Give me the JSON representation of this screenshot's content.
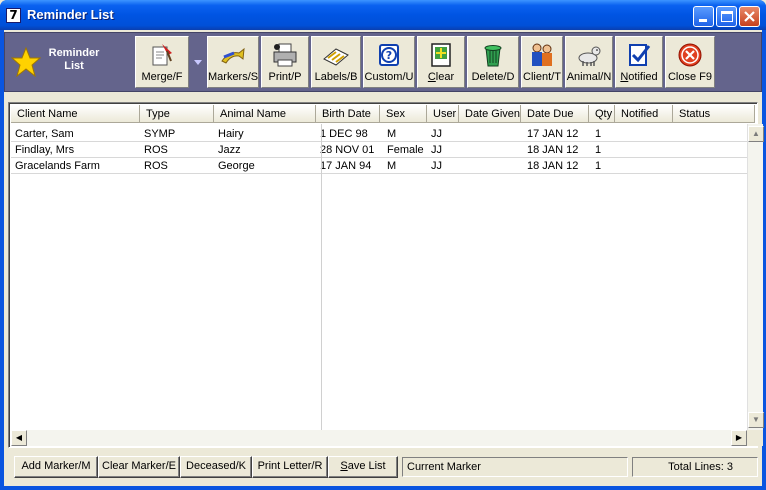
{
  "window": {
    "title": "Reminder List",
    "app_icon_glyph": "7"
  },
  "toolbar": {
    "title_line1": "Reminder",
    "title_line2": "List",
    "buttons": [
      {
        "id": "merge",
        "label": "Merge/F",
        "icon": "merge-document-icon"
      },
      {
        "id": "markers",
        "label": "Markers/S",
        "icon": "markers-icon"
      },
      {
        "id": "print",
        "label": "Print/P",
        "icon": "printer-icon"
      },
      {
        "id": "labels",
        "label": "Labels/B",
        "icon": "labels-icon"
      },
      {
        "id": "custom",
        "label": "Custom/U",
        "icon": "question-icon"
      },
      {
        "id": "clear",
        "label_pre": "",
        "label_u": "C",
        "label_post": "lear",
        "icon": "clear-list-icon"
      },
      {
        "id": "delete",
        "label": "Delete/D",
        "icon": "trash-bin-icon"
      },
      {
        "id": "client",
        "label": "Client/T",
        "icon": "client-people-icon"
      },
      {
        "id": "animal",
        "label": "Animal/N",
        "icon": "dog-icon"
      },
      {
        "id": "notified",
        "label_pre": "",
        "label_u": "N",
        "label_post": "otified",
        "icon": "notified-check-icon"
      },
      {
        "id": "close",
        "label": "Close F9",
        "icon": "close-x-icon"
      }
    ]
  },
  "columns": [
    "Client Name",
    "Type",
    "Animal Name",
    "Birth Date",
    "Sex",
    "User",
    "Date Given",
    "Date Due",
    "Qty",
    "Notified",
    "Status"
  ],
  "rows": [
    {
      "client": "Carter, Sam",
      "type": "SYMP",
      "animal": "Hairy",
      "birth": "1 DEC 98",
      "sex": "M",
      "user": "JJ",
      "given": "",
      "due": "17 JAN 12",
      "qty": "1",
      "notified": "",
      "status": ""
    },
    {
      "client": "Findlay, Mrs",
      "type": "ROS",
      "animal": "Jazz",
      "birth": "28 NOV 01",
      "sex": "Female",
      "user": "JJ",
      "given": "",
      "due": "18 JAN 12",
      "qty": "1",
      "notified": "",
      "status": ""
    },
    {
      "client": "Gracelands Farm",
      "type": "ROS",
      "animal": "George",
      "birth": "17 JAN 94",
      "sex": "M",
      "user": "JJ",
      "given": "",
      "due": "18 JAN 12",
      "qty": "1",
      "notified": "",
      "status": ""
    }
  ],
  "bottom": {
    "add_marker": "Add Marker/M",
    "clear_marker": "Clear Marker/E",
    "deceased": "Deceased/K",
    "print_letter": "Print Letter/R",
    "save_u": "S",
    "save_rest": "ave List",
    "current_marker": "Current Marker",
    "total_lines": "Total Lines: 3"
  },
  "colors": {
    "toolbar_bg": "#64648c",
    "titlebar": "#0054e3",
    "close_red": "#c8401c"
  }
}
